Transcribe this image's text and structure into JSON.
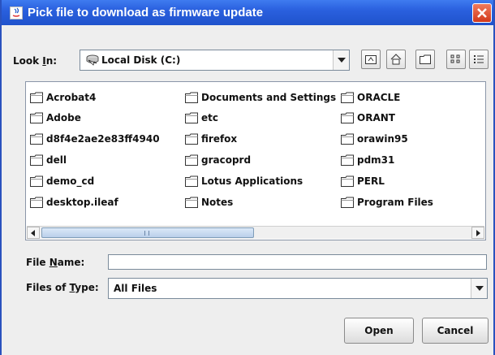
{
  "dialog": {
    "title": "Pick file to download as firmware update"
  },
  "lookin": {
    "label_prefix": "Look ",
    "label_mnemonic": "I",
    "label_suffix": "n:",
    "value": "Local Disk (C:)"
  },
  "toolbar": {
    "buttons": [
      "up-one-level",
      "home",
      "new-folder",
      "list-view",
      "details-view"
    ]
  },
  "files": {
    "col1": [
      "Acrobat4",
      "Adobe",
      "d8f4e2ae2e83ff4940",
      "dell",
      "demo_cd",
      "desktop.ileaf"
    ],
    "col2": [
      "Documents and Settings",
      "etc",
      "firefox",
      "gracoprd",
      "Lotus Applications",
      "Notes"
    ],
    "col3": [
      "ORACLE",
      "ORANT",
      "orawin95",
      "pdm31",
      "PERL",
      "Program Files"
    ]
  },
  "filename": {
    "label_prefix": "File ",
    "label_mnemonic": "N",
    "label_suffix": "ame:",
    "value": ""
  },
  "filetype": {
    "label_prefix": "Files of ",
    "label_mnemonic": "T",
    "label_suffix": "ype:",
    "value": "All Files"
  },
  "buttons": {
    "open": "Open",
    "cancel": "Cancel"
  },
  "colors": {
    "titlebar": "#2a60de",
    "close": "#d2381a",
    "scroll_thumb": "#b9cfea"
  }
}
